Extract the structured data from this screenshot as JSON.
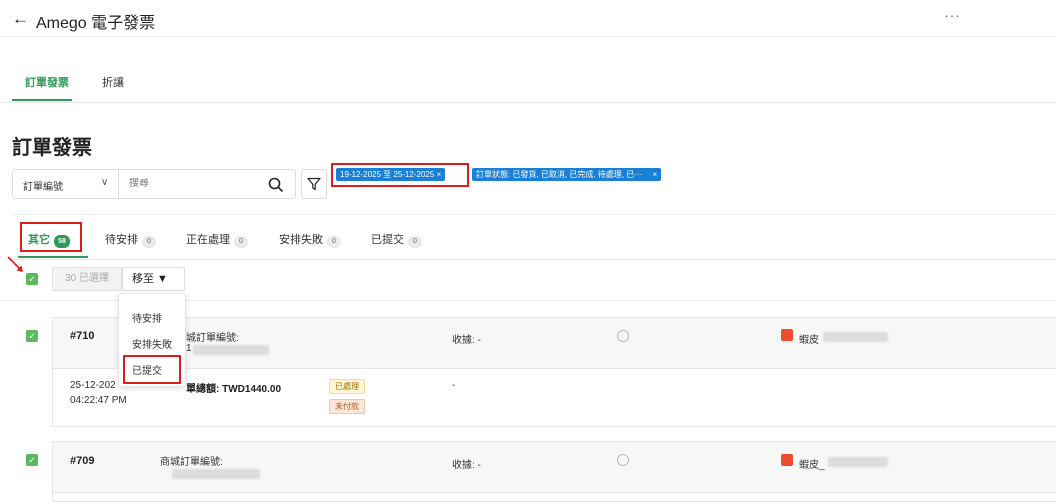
{
  "app": {
    "back_icon": "back-arrow-icon",
    "title": "Amego 電子發票",
    "more": "···"
  },
  "top_tabs": [
    {
      "label": "訂單發票",
      "active": true
    },
    {
      "label": "折讓",
      "active": false
    }
  ],
  "page_title": "訂單發票",
  "search": {
    "field_select": "訂單編號",
    "placeholder": "搜尋"
  },
  "filter_chips": [
    {
      "label": "19-12-2025 至 25-12-2025",
      "close": "×"
    },
    {
      "label": "訂單狀態: 已發貨, 已取消, 已完成, 待處理, 已···",
      "close": "×"
    }
  ],
  "status_tabs": [
    {
      "label": "其它",
      "count": "58",
      "active": true
    },
    {
      "label": "待安排",
      "count": "0"
    },
    {
      "label": "正在處理",
      "count": "0"
    },
    {
      "label": "安排失敗",
      "count": "0"
    },
    {
      "label": "已提交",
      "count": "0"
    }
  ],
  "bulk": {
    "selected_label": "30 已選擇",
    "move_label": "移至 ▼"
  },
  "move_menu": {
    "items": [
      "待安排",
      "安排失敗",
      "已提交"
    ]
  },
  "orders": [
    {
      "id": "#710",
      "platform_order_label": "城訂單編號:",
      "platform_order_prefix": "1",
      "receipt": "收據: -",
      "shop_label": "蝦皮",
      "date": "25-12-202",
      "time": "04:22:47 PM",
      "total": "單總額: TWD1440.00",
      "status_processed": "已處理",
      "status_unpaid": "未付款",
      "dash": "-"
    },
    {
      "id": "#709",
      "platform_order_label": "商城訂單編號:",
      "receipt": "收據: -",
      "shop_label": "蝦皮_"
    }
  ],
  "colors": {
    "accent": "#2e9b57",
    "chip": "#1a7fd6",
    "highlight": "#e01d1d",
    "shopee": "#ee4d2d"
  }
}
